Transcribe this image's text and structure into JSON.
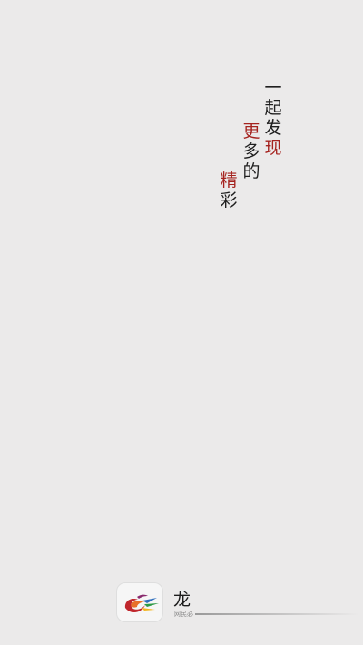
{
  "slogan": {
    "column1": [
      "一",
      "起",
      "发",
      "现"
    ],
    "column2": [
      "更",
      "多",
      "的"
    ],
    "column3": [
      "精",
      "彩"
    ],
    "highlight_color": "#a5231f",
    "text_color": "#1f1f1f"
  },
  "brand": {
    "logo_icon": "swirl-bird-logo",
    "name": "龙",
    "tagline": "网民必"
  },
  "background_color": "#ebeaea"
}
